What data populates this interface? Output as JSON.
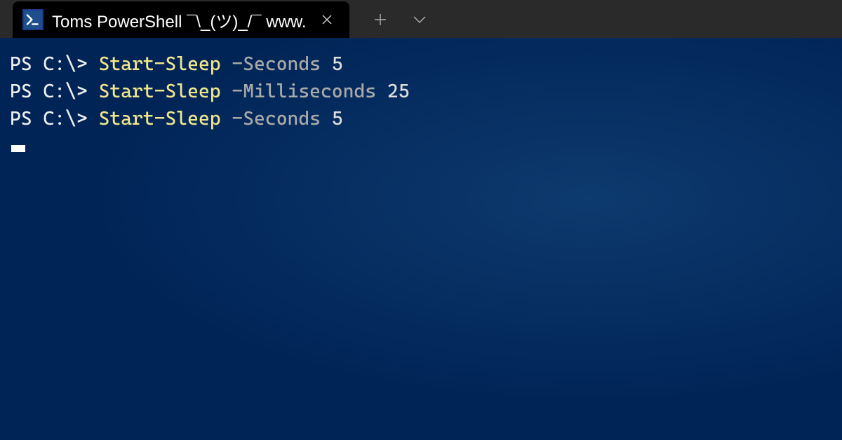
{
  "tab": {
    "title": "Toms PowerShell ¯\\_(ツ)_/¯ www.",
    "icon_name": "powershell-icon"
  },
  "terminal": {
    "lines": [
      {
        "prompt": "PS C:\\> ",
        "cmdlet": "Start-Sleep",
        "param": " -Seconds ",
        "value": "5"
      },
      {
        "prompt": "PS C:\\> ",
        "cmdlet": "Start-Sleep",
        "param": " -Milliseconds ",
        "value": "25"
      },
      {
        "prompt": "PS C:\\> ",
        "cmdlet": "Start-Sleep",
        "param": " -Seconds ",
        "value": "5"
      }
    ]
  },
  "colors": {
    "terminal_bg": "#012456",
    "prompt": "#eeeeee",
    "cmdlet": "#f0e68c",
    "param": "#a9a9a9",
    "value": "#dddddd"
  }
}
